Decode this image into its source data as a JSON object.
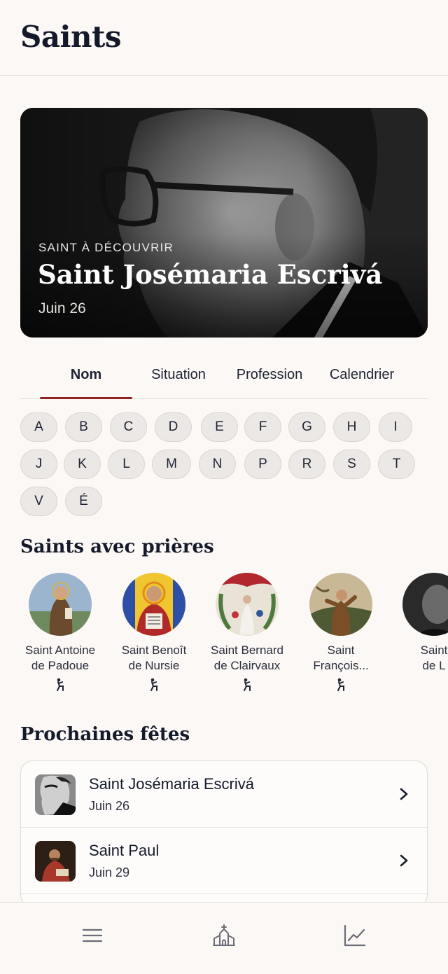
{
  "header": {
    "title": "Saints"
  },
  "hero": {
    "eyebrow": "SAINT À DÉCOUVRIR",
    "name": "Saint Josémaria Escrivá",
    "date": "Juin 26"
  },
  "tabs": [
    {
      "label": "Nom",
      "active": true
    },
    {
      "label": "Situation",
      "active": false
    },
    {
      "label": "Profession",
      "active": false
    },
    {
      "label": "Calendrier",
      "active": false
    }
  ],
  "letters": [
    "A",
    "B",
    "C",
    "D",
    "E",
    "F",
    "G",
    "H",
    "I",
    "J",
    "K",
    "L",
    "M",
    "N",
    "P",
    "R",
    "S",
    "T",
    "V",
    "É"
  ],
  "prayers_section": {
    "title": "Saints avec prières",
    "saints": [
      {
        "name": "Saint Antoine de Padoue",
        "line1": "Saint Antoine",
        "line2": "de Padoue",
        "icon": "praying-figure-icon"
      },
      {
        "name": "Saint Benoît de Nursie",
        "line1": "Saint Benoît",
        "line2": "de Nursie",
        "icon": "praying-figure-icon"
      },
      {
        "name": "Saint Bernard de Clairvaux",
        "line1": "Saint Bernard",
        "line2": "de Clairvaux",
        "icon": "praying-figure-icon"
      },
      {
        "name": "Saint François...",
        "line1": "Saint",
        "line2": "François...",
        "icon": "praying-figure-icon"
      },
      {
        "name": "Saint de L",
        "line1": "Saint",
        "line2": "de L",
        "icon": "praying-figure-icon"
      }
    ]
  },
  "feasts_section": {
    "title": "Prochaines fêtes",
    "items": [
      {
        "name": "Saint Josémaria Escrivá",
        "date": "Juin 26"
      },
      {
        "name": "Saint Paul",
        "date": "Juin 29"
      }
    ]
  },
  "tabbar": {
    "icons": [
      "menu-icon",
      "church-icon",
      "chart-icon"
    ]
  },
  "colors": {
    "background": "#fbf8f5",
    "accent": "#8f2426",
    "text": "#151a2b"
  }
}
